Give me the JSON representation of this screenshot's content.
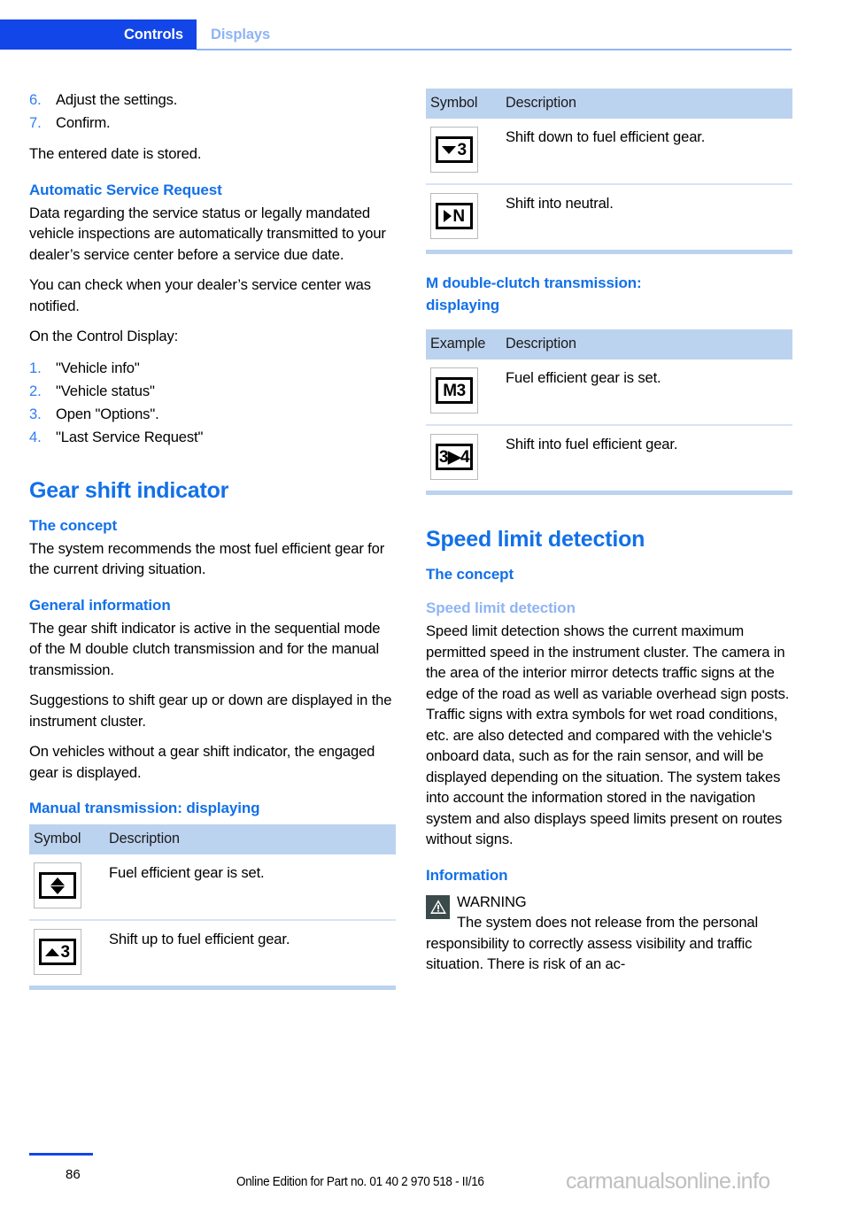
{
  "header": {
    "active_tab": "Controls",
    "inactive_tab": "Displays",
    "accent_color": "#1246e8",
    "muted_accent_color": "#8fb4f5"
  },
  "left_column": {
    "steps_top": [
      {
        "num": "6.",
        "text": "Adjust the settings."
      },
      {
        "num": "7.",
        "text": "Confirm."
      }
    ],
    "after_steps": "The entered date is stored.",
    "section_automatic_service_request": {
      "heading": "Automatic Service Request",
      "paragraphs": [
        "Data regarding the service status or legally mandated vehicle inspections are automatically transmitted to your dealer’s service center before a service due date.",
        "You can check when your dealer’s service center was notified.",
        "On the Control Display:"
      ],
      "steps": [
        {
          "num": "1.",
          "text": "\"Vehicle info\""
        },
        {
          "num": "2.",
          "text": "\"Vehicle status\""
        },
        {
          "num": "3.",
          "text": "Open \"Options\"."
        },
        {
          "num": "4.",
          "text": "\"Last Service Request\""
        }
      ]
    },
    "section_gear_shift_indicator": {
      "title": "Gear shift indicator",
      "concept_heading": "The concept",
      "concept_text": "The system recommends the most fuel efficient gear for the current driving situation.",
      "general_heading": "General information",
      "general_paragraphs": [
        "The gear shift indicator is active in the sequential mode of the M double clutch transmission and for the manual transmission.",
        "Suggestions to shift gear up or down are displayed in the instrument cluster.",
        "On vehicles without a gear shift indicator, the engaged gear is displayed."
      ],
      "manual_heading": "Manual transmission: displaying",
      "table": {
        "columns": [
          "Symbol",
          "Description"
        ],
        "rows": [
          {
            "symbol": "up-down-arrow-icon",
            "symbol_text": "",
            "description": "Fuel efficient gear is set."
          },
          {
            "symbol": "arrow-up-3-icon",
            "symbol_text": "3",
            "description": "Shift up to fuel efficient gear."
          }
        ]
      }
    }
  },
  "right_column": {
    "manual_table_continued": {
      "columns": [
        "Symbol",
        "Description"
      ],
      "rows": [
        {
          "symbol": "arrow-down-3-icon",
          "symbol_text": "3",
          "description": "Shift down to fuel efficient gear."
        },
        {
          "symbol": "arrow-right-n-icon",
          "symbol_text": "N",
          "description": "Shift into neutral."
        }
      ]
    },
    "section_m_double_clutch": {
      "heading_line1": "M double-clutch transmission:",
      "heading_line2": "displaying",
      "table": {
        "columns": [
          "Example",
          "Description"
        ],
        "rows": [
          {
            "symbol": "m3-gear-icon",
            "symbol_text": "M3",
            "description": "Fuel efficient gear is set."
          },
          {
            "symbol": "3-to-4-gear-icon",
            "symbol_text": "3▶4",
            "description": "Shift into fuel efficient gear."
          }
        ]
      }
    },
    "section_speed_limit_detection": {
      "title": "Speed limit detection",
      "concept_heading": "The concept",
      "sub_heading": "Speed limit detection",
      "body": "Speed limit detection shows the current maximum permitted speed in the instrument cluster. The camera in the area of the interior mirror detects traffic signs at the edge of the road as well as variable overhead sign posts. Traffic signs with extra symbols for wet road conditions, etc. are also detected and compared with the vehicle's onboard data, such as for the rain sensor, and will be displayed depending on the situation. The system takes into account the information stored in the navigation system and also displays speed limits present on routes without signs.",
      "information_heading": "Information",
      "warning": {
        "icon": "warning-triangle-icon",
        "title": "WARNING",
        "text": "The system does not release from the personal responsibility to correctly assess visibility and traffic situation. There is risk of an ac-"
      }
    }
  },
  "footer": {
    "page_number": "86",
    "edition": "Online Edition for Part no. 01 40 2 970 518 - II/16",
    "watermark": "carmanualsonline.info"
  }
}
